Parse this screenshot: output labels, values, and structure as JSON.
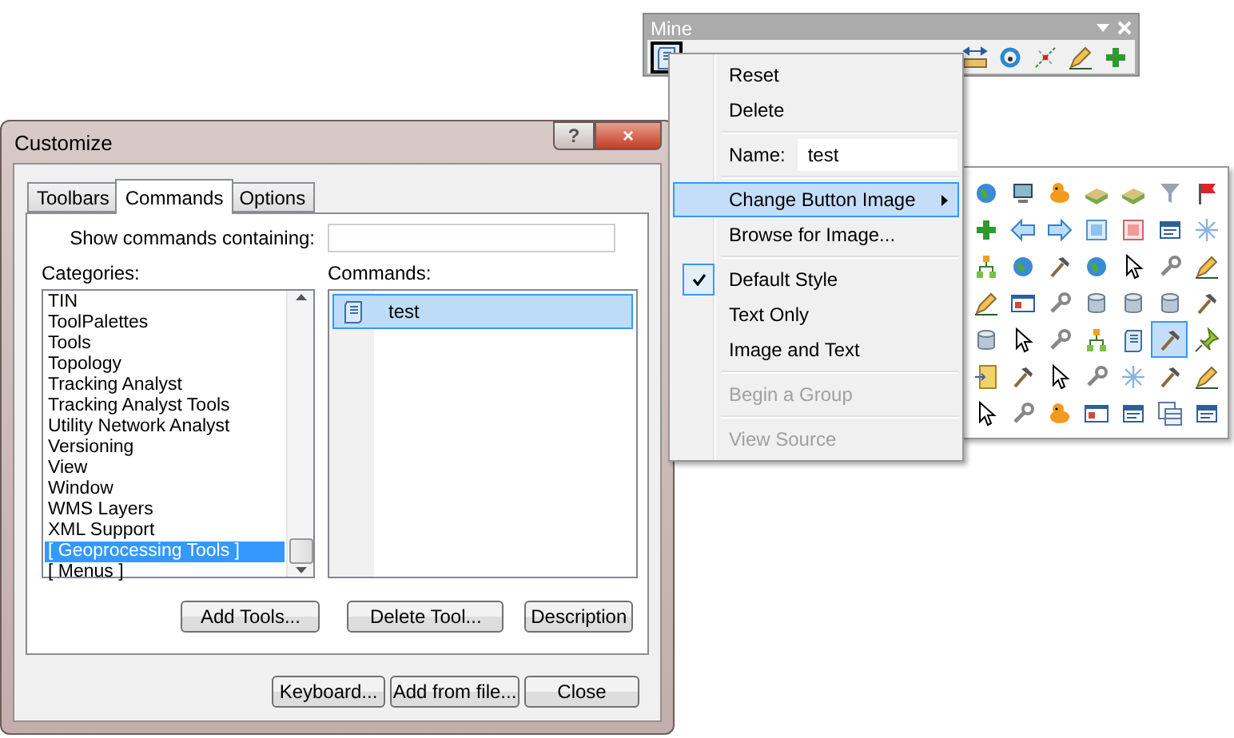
{
  "dialog": {
    "title": "Customize",
    "help": "?",
    "close": "×",
    "tabs": [
      {
        "label": "Toolbars",
        "selected": false
      },
      {
        "label": "Commands",
        "selected": true
      },
      {
        "label": "Options",
        "selected": false
      }
    ],
    "search": {
      "label": "Show commands containing:"
    },
    "categories": {
      "label": "Categories:",
      "items": [
        {
          "label": "TIN",
          "selected": false
        },
        {
          "label": "ToolPalettes",
          "selected": false
        },
        {
          "label": "Tools",
          "selected": false
        },
        {
          "label": "Topology",
          "selected": false
        },
        {
          "label": "Tracking Analyst",
          "selected": false
        },
        {
          "label": "Tracking Analyst Tools",
          "selected": false
        },
        {
          "label": "Utility Network Analyst",
          "selected": false
        },
        {
          "label": "Versioning",
          "selected": false
        },
        {
          "label": "View",
          "selected": false
        },
        {
          "label": "Window",
          "selected": false
        },
        {
          "label": "WMS Layers",
          "selected": false
        },
        {
          "label": "XML Support",
          "selected": false
        },
        {
          "label": "[ Geoprocessing Tools ]",
          "selected": true
        },
        {
          "label": "[ Menus ]",
          "selected": false
        }
      ]
    },
    "commands": {
      "label": "Commands:",
      "items": [
        {
          "label": "test",
          "selected": true
        }
      ]
    },
    "panel_buttons": [
      "Add Tools...",
      "Delete Tool...",
      "Description"
    ],
    "footer_buttons": [
      "Keyboard...",
      "Add from file...",
      "Close"
    ]
  },
  "toolbar": {
    "title": "Mine",
    "icons": [
      {
        "kind": "script",
        "selected": true
      },
      {
        "kind": "ruler",
        "selected": false
      },
      {
        "kind": "rotate",
        "selected": false
      },
      {
        "kind": "cross-line",
        "selected": false
      },
      {
        "kind": "pencil",
        "selected": false
      },
      {
        "kind": "plus",
        "selected": false
      }
    ]
  },
  "context_menu": {
    "items": [
      {
        "kind": "command",
        "label": "Reset",
        "checked": false,
        "disabled": false,
        "highlighted": false
      },
      {
        "kind": "command",
        "label": "Delete",
        "checked": false,
        "disabled": false,
        "highlighted": false
      },
      {
        "kind": "separator"
      },
      {
        "kind": "name-field",
        "label": "Name:",
        "value": "test"
      },
      {
        "kind": "separator"
      },
      {
        "kind": "submenu",
        "label": "Change Button Image",
        "checked": false,
        "disabled": false,
        "highlighted": true
      },
      {
        "kind": "command",
        "label": "Browse for Image...",
        "checked": false,
        "disabled": false,
        "highlighted": false
      },
      {
        "kind": "separator"
      },
      {
        "kind": "command",
        "label": "Default Style",
        "checked": true,
        "disabled": false,
        "highlighted": false
      },
      {
        "kind": "command",
        "label": "Text Only",
        "checked": false,
        "disabled": false,
        "highlighted": false
      },
      {
        "kind": "command",
        "label": "Image and Text",
        "checked": false,
        "disabled": false,
        "highlighted": false
      },
      {
        "kind": "separator"
      },
      {
        "kind": "command",
        "label": "Begin a Group",
        "checked": false,
        "disabled": true,
        "highlighted": false
      },
      {
        "kind": "separator"
      },
      {
        "kind": "command",
        "label": "View Source",
        "checked": false,
        "disabled": true,
        "highlighted": false
      }
    ]
  },
  "image_palette": [
    {
      "kind": "globe",
      "selected": false
    },
    {
      "kind": "monitor",
      "selected": false
    },
    {
      "kind": "dog",
      "selected": false
    },
    {
      "kind": "book",
      "selected": false
    },
    {
      "kind": "book",
      "selected": false
    },
    {
      "kind": "funnel",
      "selected": false
    },
    {
      "kind": "flag",
      "selected": false
    },
    {
      "kind": "plus",
      "selected": false
    },
    {
      "kind": "arrow-left",
      "selected": false
    },
    {
      "kind": "arrow-right",
      "selected": false
    },
    {
      "kind": "square",
      "selected": false
    },
    {
      "kind": "square-red",
      "selected": false
    },
    {
      "kind": "form",
      "selected": false
    },
    {
      "kind": "burst",
      "selected": false
    },
    {
      "kind": "network",
      "selected": false
    },
    {
      "kind": "globe",
      "selected": false
    },
    {
      "kind": "hammer",
      "selected": false
    },
    {
      "kind": "globe",
      "selected": false
    },
    {
      "kind": "pointer",
      "selected": false
    },
    {
      "kind": "wrench",
      "selected": false
    },
    {
      "kind": "pencil",
      "selected": false
    },
    {
      "kind": "pencil",
      "selected": false
    },
    {
      "kind": "window",
      "selected": false
    },
    {
      "kind": "wrench",
      "selected": false
    },
    {
      "kind": "cylinder",
      "selected": false
    },
    {
      "kind": "cylinder",
      "selected": false
    },
    {
      "kind": "cylinder",
      "selected": false
    },
    {
      "kind": "hammer",
      "selected": false
    },
    {
      "kind": "cylinder",
      "selected": false
    },
    {
      "kind": "pointer",
      "selected": false
    },
    {
      "kind": "wrench",
      "selected": false
    },
    {
      "kind": "network",
      "selected": false
    },
    {
      "kind": "script",
      "selected": false
    },
    {
      "kind": "hammer",
      "selected": true
    },
    {
      "kind": "pin",
      "selected": false
    },
    {
      "kind": "folder",
      "selected": false
    },
    {
      "kind": "hammer",
      "selected": false
    },
    {
      "kind": "pointer",
      "selected": false
    },
    {
      "kind": "wrench",
      "selected": false
    },
    {
      "kind": "burst",
      "selected": false
    },
    {
      "kind": "hammer",
      "selected": false
    },
    {
      "kind": "pencil",
      "selected": false
    },
    {
      "kind": "pointer",
      "selected": false
    },
    {
      "kind": "wrench",
      "selected": false
    },
    {
      "kind": "dog",
      "selected": false
    },
    {
      "kind": "window",
      "selected": false
    },
    {
      "kind": "form",
      "selected": false
    },
    {
      "kind": "table",
      "selected": false
    },
    {
      "kind": "form",
      "selected": false
    }
  ]
}
